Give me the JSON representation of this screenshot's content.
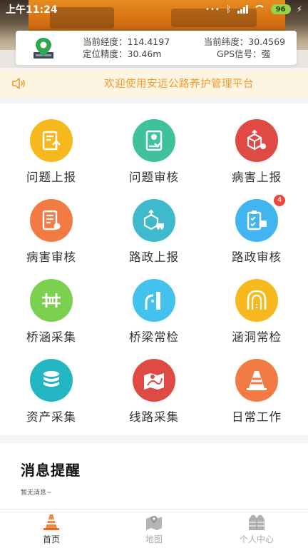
{
  "status_bar": {
    "time": "上午11:24",
    "battery": "96"
  },
  "gps": {
    "longitude_label": "当前经度：114.4197",
    "latitude_label": "当前纬度：30.4569",
    "accuracy_label": "定位精度：30.46m",
    "signal_label": "GPS信号：强"
  },
  "notice": {
    "text": "欢迎使用安远公路养护管理平台"
  },
  "menu": {
    "items": [
      {
        "label": "问题上报",
        "color": "#f7b81e",
        "icon": "report-upload-icon"
      },
      {
        "label": "问题审核",
        "color": "#3fc29b",
        "icon": "review-icon"
      },
      {
        "label": "病害上报",
        "color": "#e04a44",
        "icon": "box-bug-icon"
      },
      {
        "label": "病害审核",
        "color": "#f47a43",
        "icon": "list-bug-icon"
      },
      {
        "label": "路政上报",
        "color": "#3fb9cc",
        "icon": "box-car-icon"
      },
      {
        "label": "路政审核",
        "color": "#41b5f0",
        "icon": "clipboard-truck-icon",
        "badge": "4"
      },
      {
        "label": "桥涵采集",
        "color": "#7bd04f",
        "icon": "bridge-culvert-icon"
      },
      {
        "label": "桥梁常检",
        "color": "#44c2ee",
        "icon": "bridge-icon"
      },
      {
        "label": "涵洞常检",
        "color": "#f7b81e",
        "icon": "tunnel-icon"
      },
      {
        "label": "资产采集",
        "color": "#25b6c3",
        "icon": "database-icon"
      },
      {
        "label": "线路采集",
        "color": "#e04a44",
        "icon": "map-route-icon"
      },
      {
        "label": "日常工作",
        "color": "#f47a43",
        "icon": "traffic-cone-icon"
      }
    ]
  },
  "messages": {
    "title": "消息提醒",
    "empty_text": "暂无消息~"
  },
  "tabs": [
    {
      "label": "首页",
      "icon": "cone-home-icon",
      "active": true
    },
    {
      "label": "地图",
      "icon": "map-icon",
      "active": false
    },
    {
      "label": "个人中心",
      "icon": "vest-person-icon",
      "active": false
    }
  ]
}
